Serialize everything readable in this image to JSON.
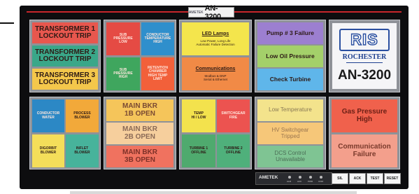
{
  "header": {
    "brand_small": "AMETEK",
    "model": "AN-3200"
  },
  "panel_top_1": {
    "tiles": [
      {
        "label": "TRANSFORMER 1\nLOCKOUT TRIP",
        "color": "#e8574e"
      },
      {
        "label": "TRANSFORMER 2\nLOCKOUT TRIP",
        "color": "#3aa789"
      },
      {
        "label": "TRANSFORMER 3\nLOCKOUT TRIP",
        "color": "#f4c74b"
      }
    ]
  },
  "panel_top_2": {
    "tiles": [
      {
        "label": "SUB\nPRESSURE\nLOW",
        "color": "#e54b44"
      },
      {
        "label": "CONDUCTOR\nTEMPERATURE\nHIGH",
        "color": "#2f8fcc"
      },
      {
        "label": "SUB\nPRESSURE\nHIGH",
        "color": "#3fa65e"
      },
      {
        "label": "RETENTION\nCHAMBER\nHIGH TEMP\nLIMIT",
        "color": "#f2603a"
      }
    ]
  },
  "panel_top_3": {
    "tiles": [
      {
        "title": "LED Lamps",
        "body": "Low Power, Long Life\nAutomatic Failure Detection",
        "color": "#f4e54c"
      },
      {
        "title": "Communications",
        "body": "Modbus & DNP\nSerial & Ethernet",
        "color": "#f18a46"
      }
    ]
  },
  "panel_top_4": {
    "tiles": [
      {
        "label": "Pump # 3 Failure",
        "color": "#9c7fd0"
      },
      {
        "label": "Low Oil Pressure",
        "color": "#a4d06a"
      },
      {
        "label": "Check Turbine",
        "color": "#5fb6ea"
      }
    ]
  },
  "ris": {
    "logo": "RIS",
    "company": "ROCHESTER",
    "model": "AN-3200"
  },
  "panel_bot_1": {
    "tiles": [
      {
        "label": "CONDUCTOR\nWATER",
        "color": "#2c88c5"
      },
      {
        "label": "PROCESS\nBLOWER",
        "color": "#f2a93a"
      },
      {
        "label": "DIGORBIT\nBLOWER",
        "color": "#f4de5a"
      },
      {
        "label": "INFLET\nBLOWER",
        "color": "#47b39b"
      }
    ]
  },
  "panel_bot_2": {
    "tiles": [
      {
        "label": "MAIN BKR\n1B OPEN",
        "color": "#f5c55a"
      },
      {
        "label": "MAIN BKR\n2B OPEN",
        "color": "#f6cf9d"
      },
      {
        "label": "MAIN BKR\n3B OPEN",
        "color": "#f0725f"
      }
    ]
  },
  "panel_bot_3": {
    "tiles": [
      {
        "label": "TEMP\nHI / LOW",
        "color": "#f3e24d"
      },
      {
        "label": "SWITCHGEAR\nFIRE",
        "color": "#ec5350"
      },
      {
        "label": "TURBINE 1\nOFFLINE",
        "color": "#4faa6e"
      },
      {
        "label": "TURBINE 2\nOFFLINE",
        "color": "#4fb07b"
      }
    ]
  },
  "panel_bot_4": {
    "tiles": [
      {
        "label": "Low Temperature",
        "color": "#f3e38c"
      },
      {
        "label": "HV Switchgear\nTripped",
        "color": "#f6c779"
      },
      {
        "label": "DCS Control\nUnavailable",
        "color": "#7fc493"
      }
    ]
  },
  "panel_bot_5": {
    "tiles": [
      {
        "label": "Gas Pressure\nHigh",
        "color": "#f0614c"
      },
      {
        "label": "Communication\nFailure",
        "color": "#f39f8c"
      }
    ]
  },
  "controls": {
    "brand": "AMETEK",
    "indicators": [
      "ALM",
      "ACK",
      "PWR",
      "COM"
    ],
    "buttons": [
      "SIL",
      "ACK",
      "TEST",
      "RESET"
    ]
  }
}
